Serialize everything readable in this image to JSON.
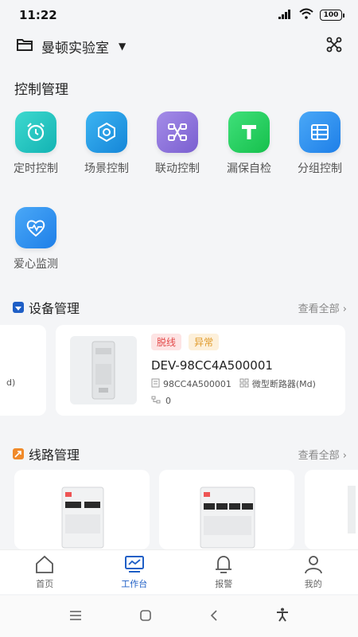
{
  "status": {
    "time": "11:22",
    "battery": "100"
  },
  "header": {
    "title": "曼顿实验室"
  },
  "control": {
    "title": "控制管理",
    "items": [
      {
        "label": "定时控制",
        "icon": "alarm-clock-icon",
        "color": "#22c2c0"
      },
      {
        "label": "场景控制",
        "icon": "scene-icon",
        "color": "#1e9ee8"
      },
      {
        "label": "联动控制",
        "icon": "linkage-icon",
        "color": "#8a70d8"
      },
      {
        "label": "漏保自检",
        "icon": "leakage-test-icon",
        "color": "#22c95a"
      },
      {
        "label": "分组控制",
        "icon": "group-icon",
        "color": "#2b8ff0"
      },
      {
        "label": "爱心监测",
        "icon": "heart-monitor-icon",
        "color": "#2b8ff0"
      }
    ]
  },
  "devices": {
    "title": "设备管理",
    "view_all": "查看全部",
    "partial_left_text": "d)",
    "card": {
      "tag_offline": "脱线",
      "tag_abnormal": "异常",
      "name": "DEV-98CC4A500001",
      "serial": "98CC4A500001",
      "type": "微型断路器(Md)",
      "lines": "0"
    }
  },
  "lines": {
    "title": "线路管理",
    "view_all": "查看全部"
  },
  "nav": {
    "items": [
      {
        "label": "首页"
      },
      {
        "label": "工作台"
      },
      {
        "label": "报警"
      },
      {
        "label": "我的"
      }
    ]
  }
}
